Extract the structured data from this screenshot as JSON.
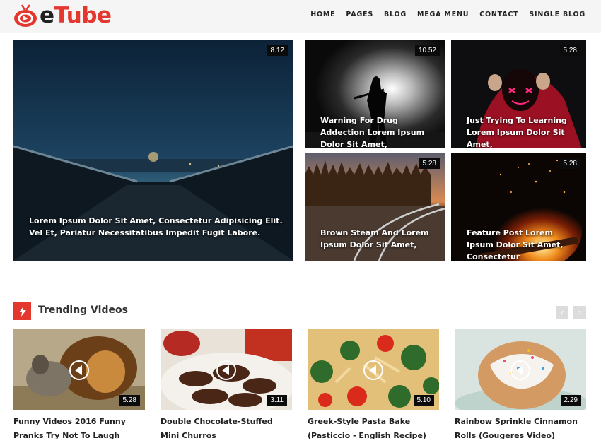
{
  "header": {
    "logo_e": "e",
    "logo_tube": "Tube",
    "nav": [
      "HOME",
      "PAGES",
      "BLOG",
      "MEGA MENU",
      "CONTACT",
      "SINGLE BLOG"
    ]
  },
  "colors": {
    "accent": "#e4372e",
    "header_bg": "#f5f5f5",
    "badge_bg": "#0b0b0b"
  },
  "hero": [
    {
      "duration": "8.12",
      "title": "Lorem Ipsum Dolor Sit Amet, Consectetur Adipisicing Elit. Vel Et, Pariatur Necessitatibus Impedit Fugit Labore."
    },
    {
      "duration": "10.52",
      "title": "Warning For Drug Addection Lorem Ipsum Dolor Sit Amet,"
    },
    {
      "duration": "5.28",
      "title": "Just Trying To Learning Lorem Ipsum Dolor Sit Amet,"
    },
    {
      "duration": "5.28",
      "title": "Brown Steam And Lorem Ipsum Dolor Sit Amet,"
    },
    {
      "duration": "5.28",
      "title": "Feature Post Lorem Ipsum Dolor Sit Amet, Consectetur"
    }
  ],
  "trending": {
    "title": "Trending Videos",
    "icon": "lightning-icon",
    "videos": [
      {
        "duration": "5.28",
        "title": "Funny Videos 2016 Funny Pranks Try Not To Laugh"
      },
      {
        "duration": "3.11",
        "title": "Double Chocolate-Stuffed Mini Churros"
      },
      {
        "duration": "5.10",
        "title": "Greek-Style Pasta Bake (Pasticcio - English Recipe)"
      },
      {
        "duration": "2.29",
        "title": "Rainbow Sprinkle Cinnamon Rolls (Gougeres Video)"
      }
    ]
  }
}
